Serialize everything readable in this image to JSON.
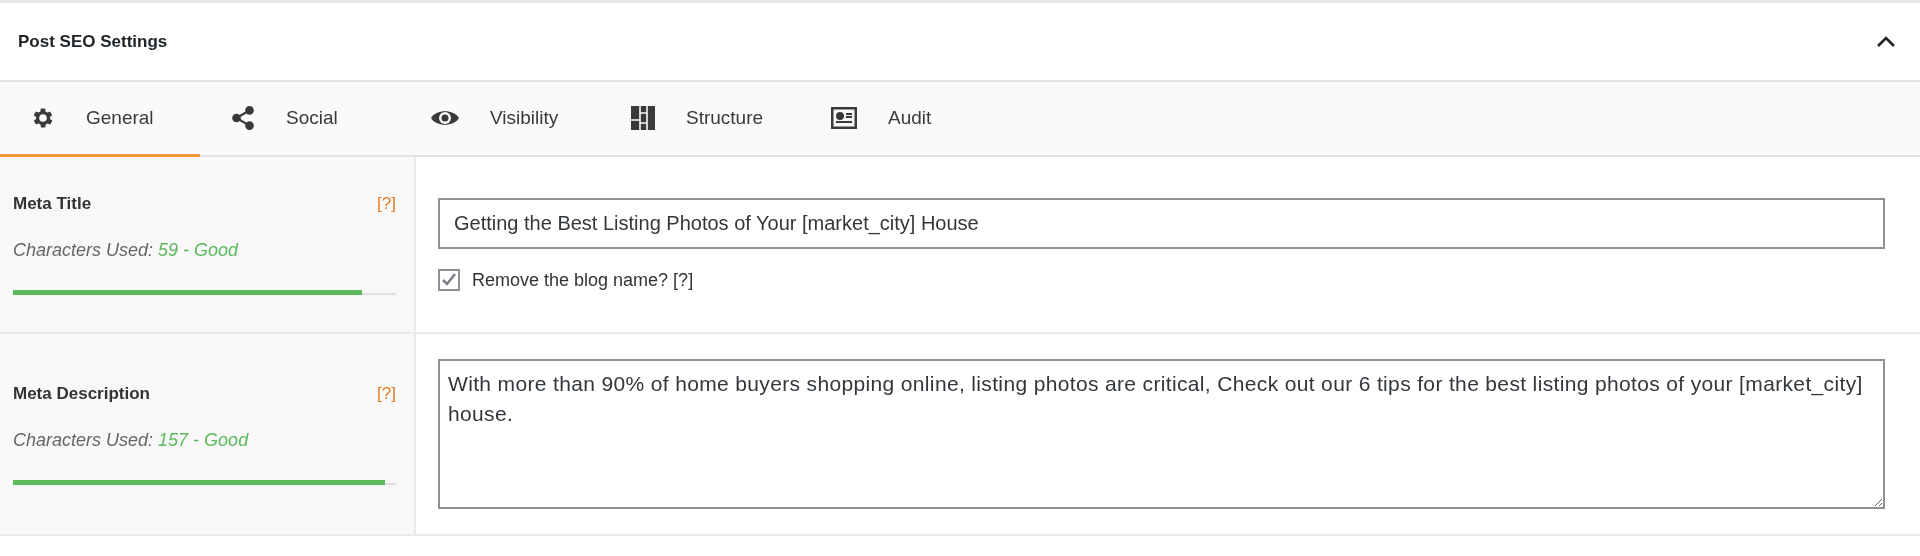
{
  "panel": {
    "title": "Post SEO Settings",
    "expanded": true
  },
  "tabs": [
    {
      "label": "General",
      "kind": "gear",
      "selected": true
    },
    {
      "label": "Social",
      "kind": "share",
      "selected": false
    },
    {
      "label": "Visibility",
      "kind": "eye",
      "selected": false
    },
    {
      "label": "Structure",
      "kind": "structure",
      "selected": false
    },
    {
      "label": "Audit",
      "kind": "audit",
      "selected": false
    }
  ],
  "fields": [
    {
      "kind": "input",
      "label": "Meta Title",
      "help": "[?]",
      "counter_label": "Characters Used:",
      "counter_value": "59 - Good",
      "level": 0.91,
      "value": "Getting the Best Listing Photos of Your [market_city] House",
      "checkbox": {
        "label": "Remove the blog name? [?]",
        "checked": true
      }
    },
    {
      "kind": "textarea",
      "label": "Meta Description",
      "help": "[?]",
      "counter_label": "Characters Used:",
      "counter_value": "157 - Good",
      "level": 0.97,
      "value": "With more than 90% of home buyers shopping online, listing photos are critical, Check out our 6 tips for the best listing photos of your [market_city] house."
    }
  ]
}
